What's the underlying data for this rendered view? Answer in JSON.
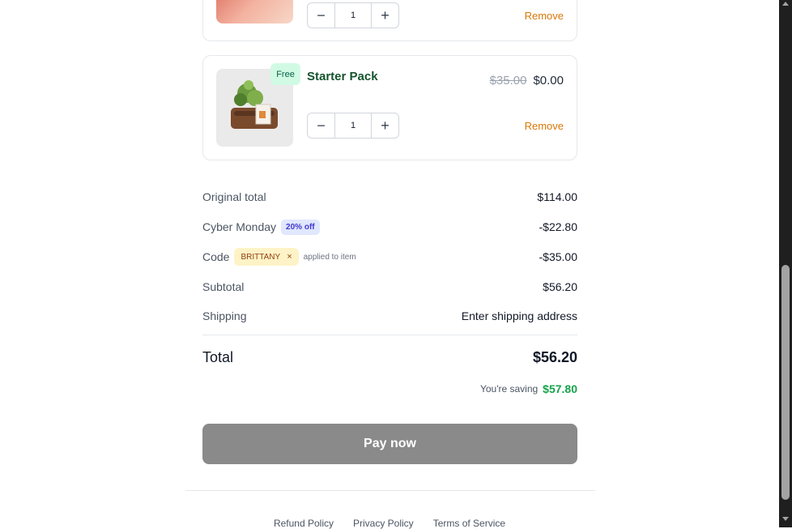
{
  "cart_items": [
    {
      "quantity": "1",
      "remove_label": "Remove"
    },
    {
      "badge": "Free",
      "name": "Starter Pack",
      "original_price": "$35.00",
      "price": "$0.00",
      "quantity": "1",
      "remove_label": "Remove"
    }
  ],
  "summary": {
    "original_total_label": "Original total",
    "original_total_value": "$114.00",
    "discount_label": "Cyber Monday",
    "discount_badge": "20% off",
    "discount_value": "-$22.80",
    "code_label": "Code",
    "code_value_badge": "BRITTANY",
    "code_note": "applied to item",
    "code_value": "-$35.00",
    "subtotal_label": "Subtotal",
    "subtotal_value": "$56.20",
    "shipping_label": "Shipping",
    "shipping_value": "Enter shipping address",
    "total_label": "Total",
    "total_value": "$56.20",
    "saving_label": "You're saving",
    "saving_value": "$57.80"
  },
  "pay_button_label": "Pay now",
  "footer_links": [
    "Refund Policy",
    "Privacy Policy",
    "Terms of Service"
  ],
  "colors": {
    "accent_green": "#16a34a",
    "remove_orange": "#d97706",
    "pay_button_gray": "#8a8a8a"
  },
  "icons": [
    "minus-icon",
    "plus-icon",
    "close-icon",
    "scroll-up-icon",
    "scroll-down-icon"
  ]
}
